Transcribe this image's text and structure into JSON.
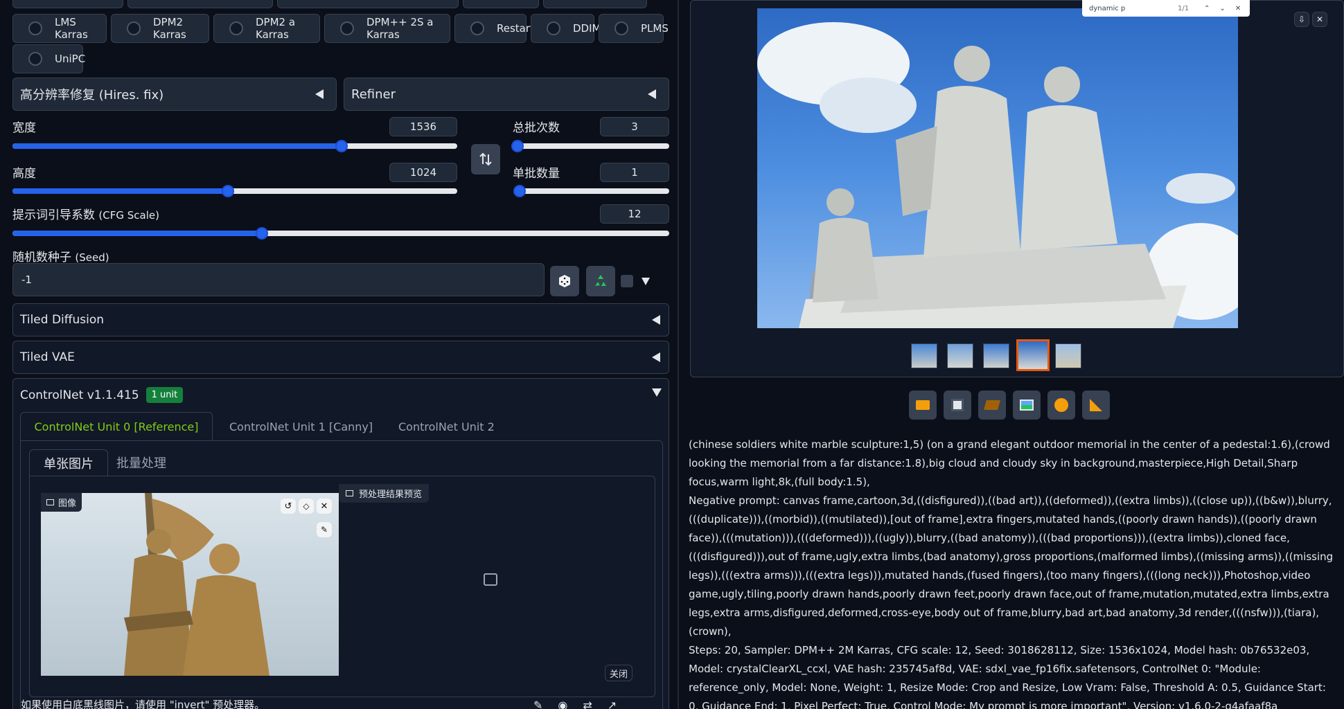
{
  "samplers_top": [
    "",
    "",
    "",
    "",
    ""
  ],
  "samplers_row1": [
    "LMS Karras",
    "DPM2 Karras",
    "DPM2 a Karras",
    "DPM++ 2S a Karras",
    "Restart",
    "DDIM",
    "PLMS"
  ],
  "samplers_row2": [
    "UniPC"
  ],
  "hires": {
    "title": "高分辨率修复 (Hires. fix)"
  },
  "refiner": {
    "title": "Refiner"
  },
  "width": {
    "label": "宽度",
    "value": "1536",
    "fraction": 0.74
  },
  "height": {
    "label": "高度",
    "value": "1024",
    "fraction": 0.485
  },
  "batch_count": {
    "label": "总批次数",
    "value": "3",
    "fraction": 0.015
  },
  "batch_size": {
    "label": "单批数量",
    "value": "1",
    "fraction": 0.0
  },
  "cfg": {
    "label": "提示词引导系数",
    "label_en": "(CFG Scale)",
    "value": "12",
    "fraction": 0.38
  },
  "seed": {
    "label": "随机数种子",
    "label_en": "(Seed)",
    "value": "-1"
  },
  "tiled_diffusion": "Tiled Diffusion",
  "tiled_vae": "Tiled VAE",
  "controlnet": {
    "title": "ControlNet v1.1.415",
    "badge": "1 unit",
    "tabs": [
      "ControlNet Unit 0 [Reference]",
      "ControlNet Unit 1 [Canny]",
      "ControlNet Unit 2"
    ],
    "subtabs": [
      "单张图片",
      "批量处理"
    ],
    "image_label": "图像",
    "preview_label": "预处理结果预览",
    "close_label": "关闭",
    "hint": "如果使用白底黑线图片，请使用 \"invert\" 预处理器。"
  },
  "search_bar": {
    "query": "dynamic p",
    "count": "1/1"
  },
  "colors": {
    "accent": "#2563eb",
    "badge": "#15803d",
    "tab_active": "#84cc16",
    "thumb_selected": "#ea580c"
  },
  "infotext": {
    "prompt": "(chinese soldiers white marble sculpture:1,5) (on a grand elegant outdoor memorial in the center of a pedestal:1.6),(crowd looking the memorial from a far distance:1.8),big cloud and cloudy sky in background,masterpiece,High Detail,Sharp focus,warm light,8k,(full body:1.5),",
    "negative": "Negative prompt: canvas frame,cartoon,3d,((disfigured)),((bad art)),((deformed)),((extra limbs)),((close up)),((b&w)),blurry,(((duplicate))),((morbid)),((mutilated)),[out of frame],extra fingers,mutated hands,((poorly drawn hands)),((poorly drawn face)),(((mutation))),(((deformed))),((ugly)),blurry,((bad anatomy)),(((bad proportions))),((extra limbs)),cloned face,(((disfigured))),out of frame,ugly,extra limbs,(bad anatomy),gross proportions,(malformed limbs),((missing arms)),((missing legs)),(((extra arms))),(((extra legs))),mutated hands,(fused fingers),(too many fingers),(((long neck))),Photoshop,video game,ugly,tiling,poorly drawn hands,poorly drawn feet,poorly drawn face,out of frame,mutation,mutated,extra limbs,extra legs,extra arms,disfigured,deformed,cross-eye,body out of frame,blurry,bad art,bad anatomy,3d render,(((nsfw))),(tiara),(crown),",
    "params": "Steps: 20, Sampler: DPM++ 2M Karras, CFG scale: 12, Seed: 3018628112, Size: 1536x1024, Model hash: 0b76532e03, Model: crystalClearXL_ccxl, VAE hash: 235745af8d, VAE: sdxl_vae_fp16fix.safetensors, ControlNet 0: \"Module: reference_only, Model: None, Weight: 1, Resize Mode: Crop and Resize, Low Vram: False, Threshold A: 0.5, Guidance Start: 0, Guidance End: 1, Pixel Perfect: True, Control Mode: My prompt is more important\", Version: v1.6.0-2-g4afaaf8a"
  }
}
